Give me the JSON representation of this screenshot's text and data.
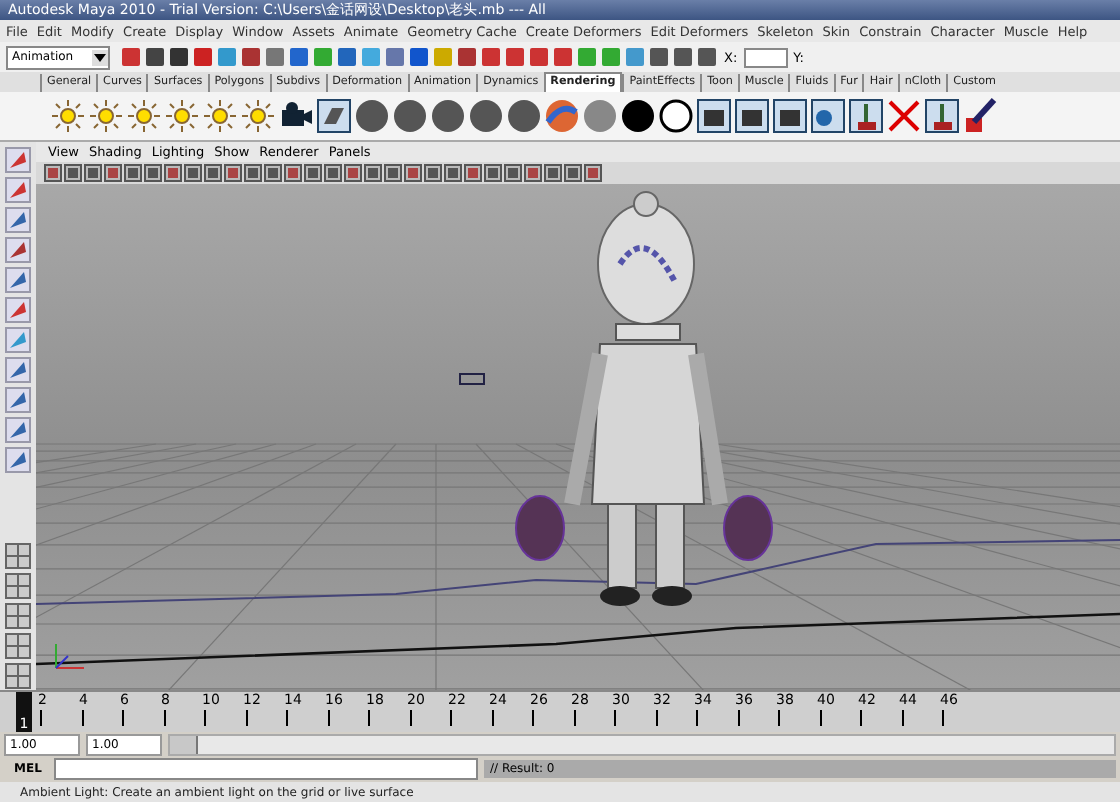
{
  "window": {
    "title": "Autodesk Maya 2010 - Trial Version: C:\\Users\\金话网设\\Desktop\\老头.mb  ---  All"
  },
  "menu_bar": [
    "File",
    "Edit",
    "Modify",
    "Create",
    "Display",
    "Window",
    "Assets",
    "Animate",
    "Geometry Cache",
    "Create Deformers",
    "Edit Deformers",
    "Skeleton",
    "Skin",
    "Constrain",
    "Character",
    "Muscle",
    "Help"
  ],
  "status_line": {
    "mode": "Animation",
    "x_label": "X:",
    "y_label": "Y:"
  },
  "shelf": {
    "tabs": [
      {
        "label": "General",
        "selected": false
      },
      {
        "label": "Curves",
        "selected": false
      },
      {
        "label": "Surfaces",
        "selected": false
      },
      {
        "label": "Polygons",
        "selected": false
      },
      {
        "label": "Subdivs",
        "selected": false
      },
      {
        "label": "Deformation",
        "selected": false
      },
      {
        "label": "Animation",
        "selected": false
      },
      {
        "label": "Dynamics",
        "selected": false
      },
      {
        "label": "Rendering",
        "selected": true
      },
      {
        "label": "PaintEffects",
        "selected": false
      },
      {
        "label": "Toon",
        "selected": false
      },
      {
        "label": "Muscle",
        "selected": false
      },
      {
        "label": "Fluids",
        "selected": false
      },
      {
        "label": "Fur",
        "selected": false
      },
      {
        "label": "Hair",
        "selected": false
      },
      {
        "label": "nCloth",
        "selected": false
      },
      {
        "label": "Custom",
        "selected": false
      }
    ]
  },
  "panel": {
    "menus": [
      "View",
      "Shading",
      "Lighting",
      "Show",
      "Renderer",
      "Panels"
    ]
  },
  "time_slider": {
    "current_frame": "1",
    "level": 0,
    "ticks": [
      "2",
      "4",
      "6",
      "8",
      "10",
      "12",
      "14",
      "16",
      "18",
      "20",
      "22",
      "24",
      "26",
      "28",
      "30",
      "32",
      "34",
      "36",
      "38",
      "40",
      "42",
      "44",
      "46"
    ]
  },
  "range_slider": {
    "start": "1.00",
    "end": "1.00",
    "level": 0.03
  },
  "command_line": {
    "label": "MEL",
    "result": "// Result: 0"
  },
  "help_line": "Ambient Light: Create an ambient light on the grid or live surface"
}
